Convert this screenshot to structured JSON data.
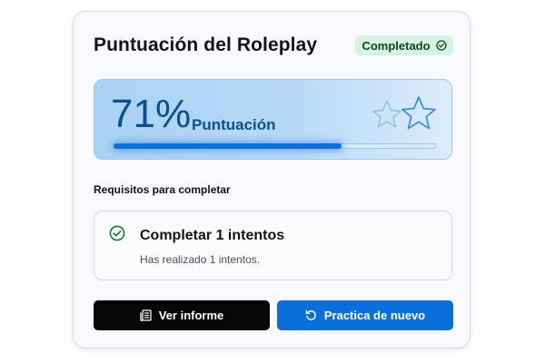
{
  "card": {
    "title": "Puntuación del Roleplay",
    "status_badge": {
      "label": "Completado",
      "icon": "check-circle-icon",
      "bg_color": "#d7f3df",
      "text_color": "#17412a"
    }
  },
  "score": {
    "percent_text": "71%",
    "label": "Puntuación",
    "progress": 0.71,
    "icon": "stars-icon",
    "accent_color": "#0e6fd6"
  },
  "requirements": {
    "heading": "Requisitos para completar",
    "items": [
      {
        "title": "Completar 1 intentos",
        "detail": "Has realizado 1 intentos.",
        "icon": "check-circle-icon",
        "icon_color": "#1c7a3a"
      }
    ]
  },
  "actions": {
    "report_button": {
      "label": "Ver informe",
      "icon": "document-icon",
      "bg_color": "#050607"
    },
    "retry_button": {
      "label": "Practica de nuevo",
      "icon": "refresh-icon",
      "bg_color": "#0a6fd8"
    }
  }
}
